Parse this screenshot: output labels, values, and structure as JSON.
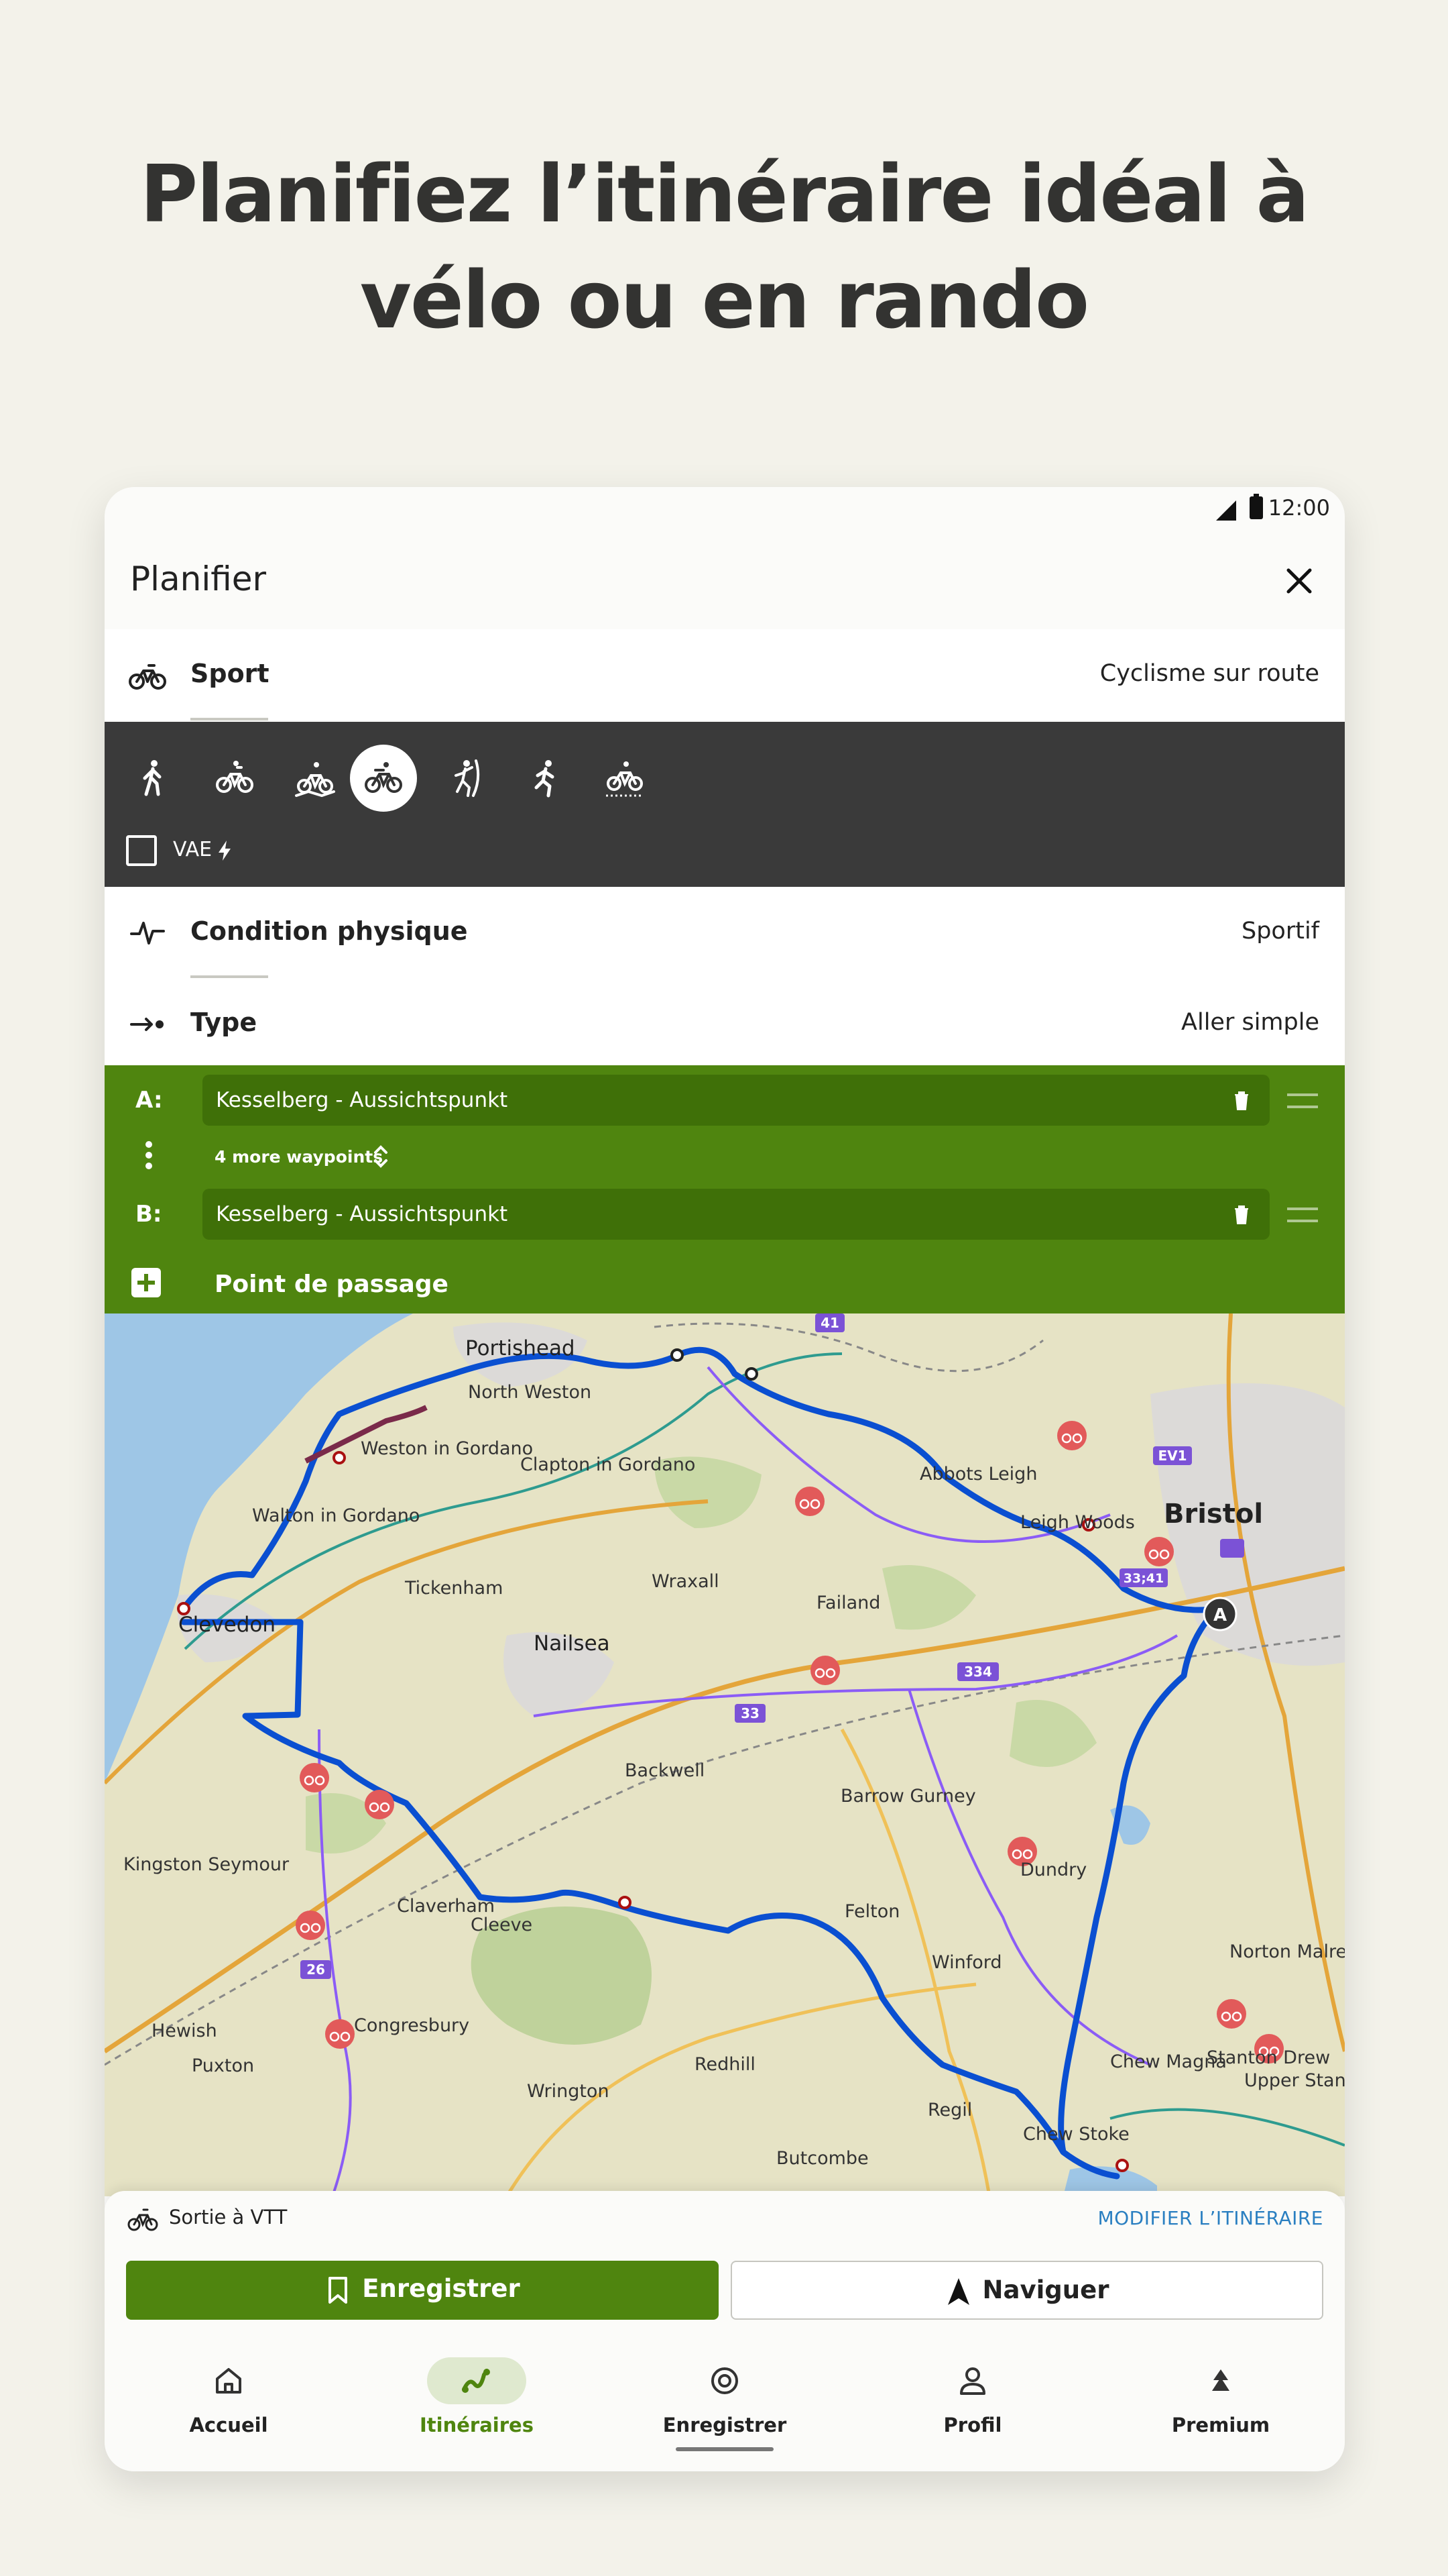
{
  "headline": {
    "line1": "Planifiez l’itinéraire idéal à",
    "line2": "vélo ou en rando"
  },
  "status": {
    "time": "12:00"
  },
  "header": {
    "title": "Planifier"
  },
  "sport": {
    "label": "Sport",
    "value": "Cyclisme sur route"
  },
  "sport_types": [
    "hiking-icon",
    "bike-icon",
    "mountain-bike-icon",
    "road-bike-icon",
    "climbing-icon",
    "running-icon",
    "gravel-bike-icon"
  ],
  "vae": {
    "label": "VAE",
    "checked": false
  },
  "fitness": {
    "label": "Condition physique",
    "value": "Sportif"
  },
  "type": {
    "label": "Type",
    "value": "Aller simple"
  },
  "waypoints": {
    "a_label": "A:",
    "a_value": "Kesselberg - Aussichtspunkt",
    "more": "4 more waypoints",
    "b_label": "B:",
    "b_value": "Kesselberg - Aussichtspunkt",
    "add": "Point de passage"
  },
  "map": {
    "places": [
      "Portishead",
      "North Weston",
      "Weston in Gordano",
      "Clapton in Gordano",
      "Walton in Gordano",
      "Bristol",
      "Abbots Leigh",
      "Leigh Woods",
      "Tickenham",
      "Wraxall",
      "Failand",
      "Clevedon",
      "Nailsea",
      "Backwell",
      "Barrow Gurney",
      "Dundry",
      "Kingston Seymour",
      "Claverham",
      "Cleeve",
      "Felton",
      "Winford",
      "Norton Malreward",
      "Congresbury",
      "Hewish",
      "Puxton",
      "Redhill",
      "Wrington",
      "Chew Magna",
      "Stanton Drew",
      "Upper Stanton",
      "Regil",
      "Chew Stoke",
      "Butcombe"
    ],
    "route_badges": [
      "41",
      "EV1",
      "33;41",
      "334",
      "33",
      "26"
    ],
    "start_marker": "A",
    "colors": {
      "route": "#0a4fd1",
      "water": "#9ec6e6",
      "bike_poi": "#e25a5a"
    }
  },
  "activity": {
    "name": "Sortie à VTT",
    "edit": "MODIFIER L’ITINÉRAIRE"
  },
  "actions": {
    "save": "Enregistrer",
    "navigate": "Naviguer"
  },
  "nav": {
    "tabs": [
      {
        "label": "Accueil",
        "icon": "home-icon",
        "active": false
      },
      {
        "label": "Itinéraires",
        "icon": "routes-icon",
        "active": true
      },
      {
        "label": "Enregistrer",
        "icon": "record-icon",
        "active": false
      },
      {
        "label": "Profil",
        "icon": "profile-icon",
        "active": false
      },
      {
        "label": "Premium",
        "icon": "premium-icon",
        "active": false
      }
    ]
  },
  "accent": "#4f850f"
}
